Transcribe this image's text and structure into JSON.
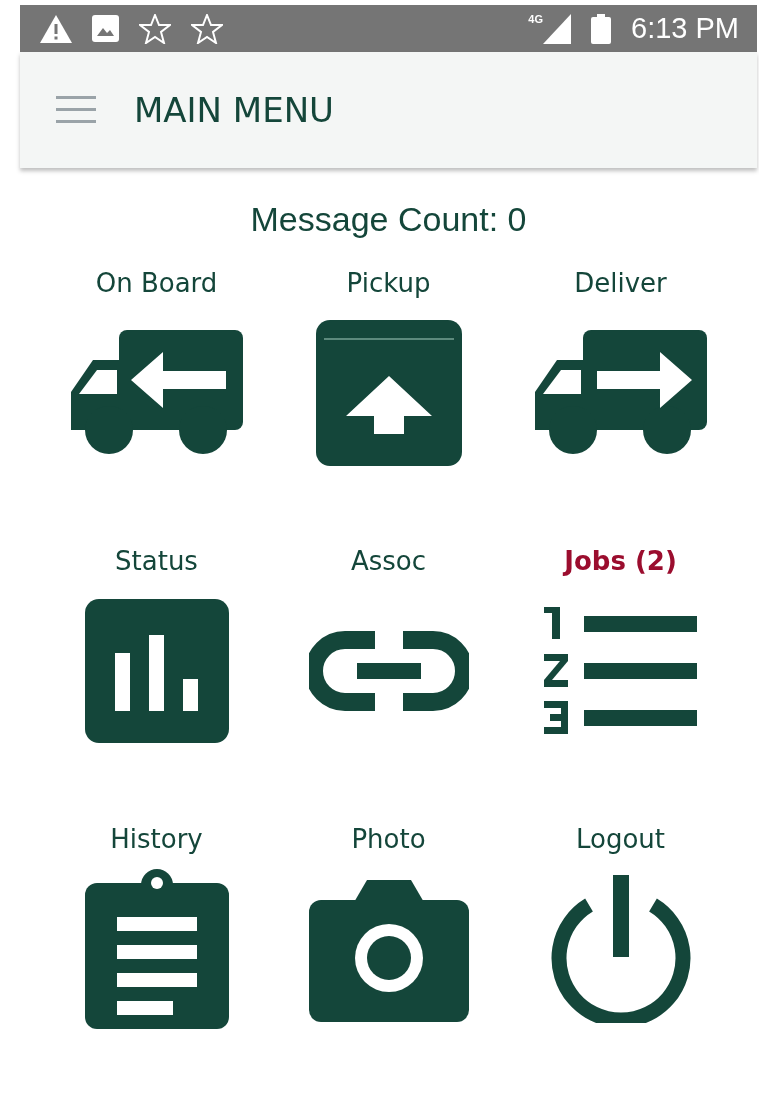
{
  "status_bar": {
    "network": "4G",
    "time": "6:13 PM"
  },
  "app_bar": {
    "title": "MAIN MENU"
  },
  "message_count": "Message Count: 0",
  "tiles": [
    {
      "label": "On Board",
      "kind": "truck-left",
      "alert": false
    },
    {
      "label": "Pickup",
      "kind": "box-up",
      "alert": false
    },
    {
      "label": "Deliver",
      "kind": "truck-right",
      "alert": false
    },
    {
      "label": "Status",
      "kind": "chart",
      "alert": false
    },
    {
      "label": "Assoc",
      "kind": "link",
      "alert": false
    },
    {
      "label": "Jobs (2)",
      "kind": "list",
      "alert": true
    },
    {
      "label": "History",
      "kind": "clipboard",
      "alert": false
    },
    {
      "label": "Photo",
      "kind": "camera",
      "alert": false
    },
    {
      "label": "Logout",
      "kind": "power",
      "alert": false
    }
  ]
}
